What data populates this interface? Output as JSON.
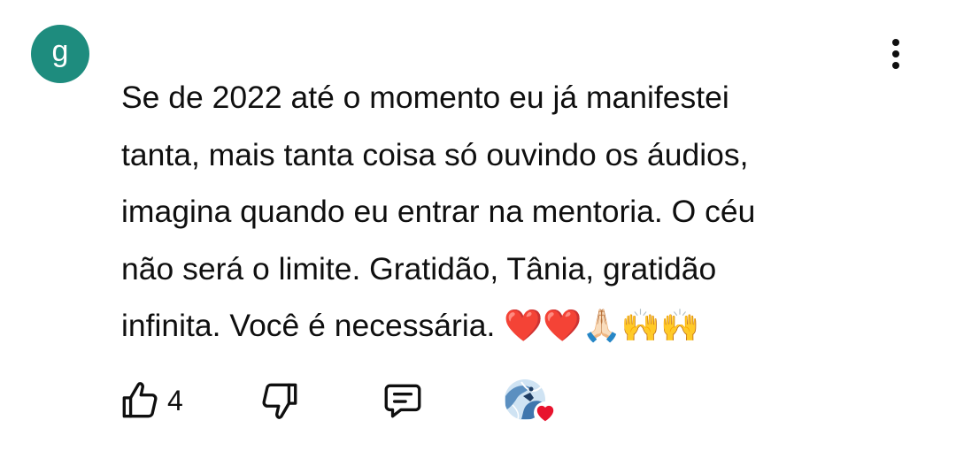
{
  "comment": {
    "author_initial": "g",
    "avatar_color": "#1e8c7e",
    "text_lines": [
      "Se de 2022 até o momento eu já manifestei",
      "tanta, mais tanta coisa só ouvindo os áudios,",
      "imagina quando eu entrar na mentoria. O céu",
      "não será o limite. Gratidão, Tânia, gratidão",
      "infinita. Você é necessária. ❤️❤️🙏🏻🙌🙌"
    ]
  },
  "actions": {
    "like_icon": "thumbs-up-icon",
    "like_count": "4",
    "dislike_icon": "thumbs-down-icon",
    "reply_icon": "comment-icon",
    "creator_heart_icon": "creator-heart-icon",
    "heart_color": "#e8132d"
  },
  "menu": {
    "icon": "more-vertical-icon"
  }
}
